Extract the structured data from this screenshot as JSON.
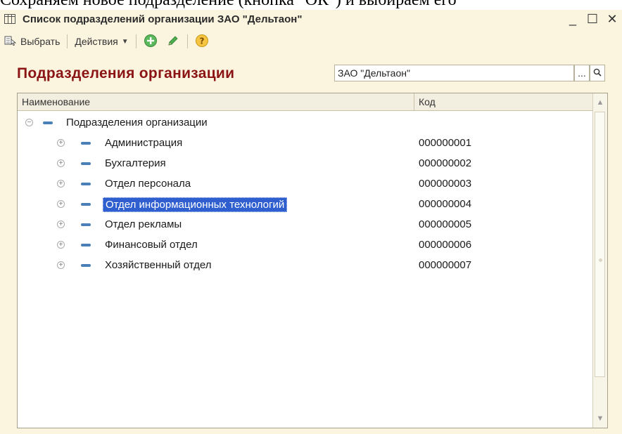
{
  "document": {
    "text": "Сохраняем новое подразделение (кнопка \"ОК\") и выбираем его"
  },
  "window": {
    "title": "Список подразделений организации ЗАО \"Дельтаон\"",
    "controls": {
      "minimize": "_",
      "maximize": "☐",
      "close": "✕"
    }
  },
  "toolbar": {
    "select_label": "Выбрать",
    "actions_label": "Действия",
    "icons": [
      "add-icon",
      "edit-pencil-icon",
      "help-icon"
    ]
  },
  "header": {
    "title": "Подразделения организации",
    "org_value": "ЗАО \"Дельтаон\"",
    "select_button": "...",
    "open_button": "Q"
  },
  "grid": {
    "columns": [
      "Наименование",
      "Код"
    ],
    "root": {
      "name": "Подразделения организации",
      "code": ""
    },
    "rows": [
      {
        "name": "Администрация",
        "code": "000000001"
      },
      {
        "name": "Бухгалтерия",
        "code": "000000002"
      },
      {
        "name": "Отдел персонала",
        "code": "000000003"
      },
      {
        "name": "Отдел информационных технологий",
        "code": "000000004",
        "selected": true
      },
      {
        "name": "Отдел рекламы",
        "code": "000000005"
      },
      {
        "name": "Финансовый отдел",
        "code": "000000006"
      },
      {
        "name": "Хозяйственный отдел",
        "code": "000000007"
      }
    ]
  },
  "colors": {
    "window_bg": "#fbf5e0",
    "section_title": "#8b1414",
    "selection": "#2f5fcf",
    "tree_dash": "#4a7fb7"
  }
}
